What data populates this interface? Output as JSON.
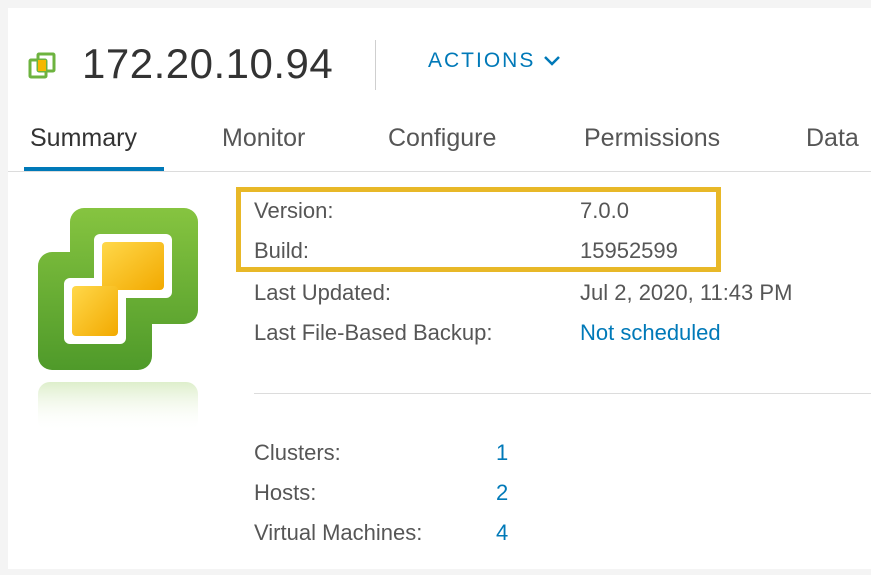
{
  "header": {
    "icon": "vcenter-server-icon",
    "title": "172.20.10.94",
    "actions_label": "ACTIONS"
  },
  "tabs": [
    {
      "label": "Summary",
      "active": true
    },
    {
      "label": "Monitor",
      "active": false
    },
    {
      "label": "Configure",
      "active": false
    },
    {
      "label": "Permissions",
      "active": false
    },
    {
      "label": "Data",
      "active": false
    }
  ],
  "summary": {
    "logo": "vsphere-logo-icon",
    "rows": [
      {
        "label": "Version:",
        "value": "7.0.0"
      },
      {
        "label": "Build:",
        "value": "15952599"
      },
      {
        "label": "Last Updated:",
        "value": "Jul 2, 2020, 11:43 PM"
      },
      {
        "label": "Last File-Based Backup:",
        "value": "Not scheduled"
      }
    ],
    "counts": [
      {
        "label": "Clusters:",
        "value": "1"
      },
      {
        "label": "Hosts:",
        "value": "2"
      },
      {
        "label": "Virtual Machines:",
        "value": "4"
      }
    ]
  },
  "colors": {
    "accent": "#0079b8",
    "highlight": "#e8b828",
    "logo_green": "#6db33f",
    "logo_yellow": "#f5b800"
  }
}
